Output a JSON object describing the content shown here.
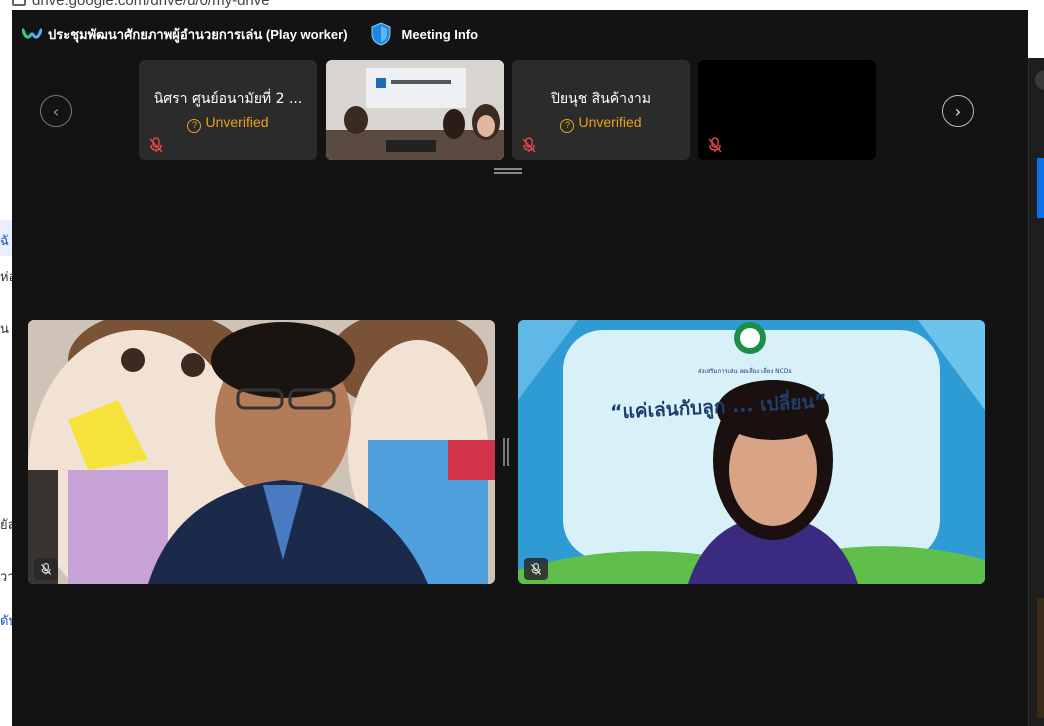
{
  "browser": {
    "url_fragment": "drive.google.com/drive/u/0/my-drive",
    "left_fragments": [
      "ฉั",
      "ห่อ",
      "น",
      "ยัล",
      "วา",
      "ดับ"
    ]
  },
  "meeting": {
    "title": "ประชุมพัฒนาศักยภาพผู้อำนวยการเล่น (Play worker)",
    "info_label": "Meeting Info"
  },
  "participants_strip": [
    {
      "name": "นิศรา ศูนย์อนามัยที่ 2 ...",
      "status": "Unverified",
      "muted": true
    },
    {
      "name": "",
      "status": "",
      "muted": true,
      "video": true
    },
    {
      "name": "ปิยนุช สินค้างาม",
      "status": "Unverified",
      "muted": true
    },
    {
      "name": "",
      "status": "",
      "muted": true,
      "video_off": true
    }
  ],
  "video_panels": [
    {
      "background_text": "",
      "muted": true
    },
    {
      "banner_small": "ส่งเสริมการเล่น ลดเสี่ยง เลี่ยง NCDs",
      "banner_main": "“แค่เล่นกับลูก ... เปลี่ยน”",
      "muted": true
    }
  ],
  "colors": {
    "accent": "#0e71eb",
    "unverified": "#e8a317",
    "background": "#131313"
  }
}
